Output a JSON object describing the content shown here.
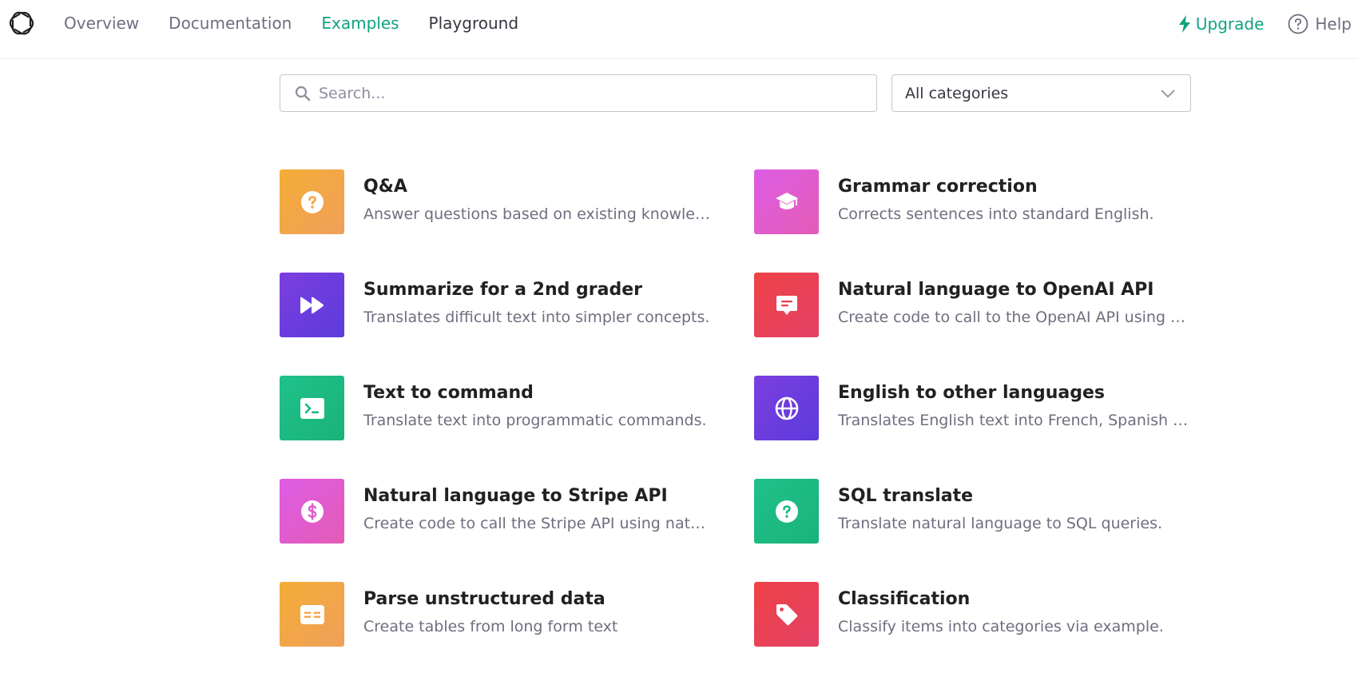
{
  "nav": {
    "items": [
      {
        "label": "Overview"
      },
      {
        "label": "Documentation"
      },
      {
        "label": "Examples"
      },
      {
        "label": "Playground"
      }
    ],
    "active_item": "Examples",
    "upgrade_label": "Upgrade",
    "help_label": "Help"
  },
  "filters": {
    "search_placeholder": "Search...",
    "search_value": "",
    "category_selected": "All categories"
  },
  "colors": {
    "accent": "#10a37f",
    "orange": "#f4ac36",
    "pink": "#dd5ce5",
    "purple": "#6a3ee0",
    "red": "#ef4146",
    "green": "#1fc18a"
  },
  "examples": [
    {
      "title": "Q&A",
      "description": "Answer questions based on existing knowledge.",
      "icon": "question-icon",
      "color": "orange"
    },
    {
      "title": "Grammar correction",
      "description": "Corrects sentences into standard English.",
      "icon": "graduation-cap-icon",
      "color": "pink"
    },
    {
      "title": "Summarize for a 2nd grader",
      "description": "Translates difficult text into simpler concepts.",
      "icon": "fast-forward-icon",
      "color": "purple"
    },
    {
      "title": "Natural language to OpenAI API",
      "description": "Create code to call to the OpenAI API using a natural language instruction.",
      "icon": "chat-bubble-icon",
      "color": "red"
    },
    {
      "title": "Text to command",
      "description": "Translate text into programmatic commands.",
      "icon": "terminal-icon",
      "color": "green"
    },
    {
      "title": "English to other languages",
      "description": "Translates English text into French, Spanish and Japanese.",
      "icon": "globe-icon",
      "color": "purple"
    },
    {
      "title": "Natural language to Stripe API",
      "description": "Create code to call the Stripe API using natural language.",
      "icon": "dollar-icon",
      "color": "pink"
    },
    {
      "title": "SQL translate",
      "description": "Translate natural language to SQL queries.",
      "icon": "question-icon",
      "color": "green"
    },
    {
      "title": "Parse unstructured data",
      "description": "Create tables from long form text",
      "icon": "table-icon",
      "color": "orange"
    },
    {
      "title": "Classification",
      "description": "Classify items into categories via example.",
      "icon": "tag-icon",
      "color": "red"
    }
  ]
}
